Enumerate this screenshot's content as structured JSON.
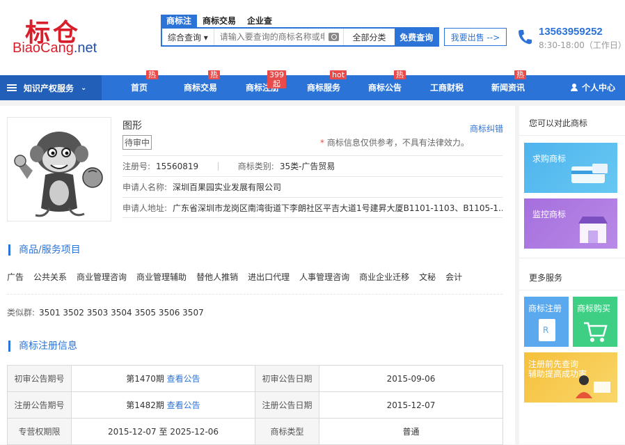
{
  "logo": {
    "cn": "标仓",
    "en_a": "BiaoCang",
    "en_b": ".net"
  },
  "search": {
    "tabs": [
      "商标注",
      "商标交易",
      "企业查"
    ],
    "select": "综合查询 ▾",
    "placeholder": "请输入要查询的商标名称或申",
    "category": "全部分类",
    "button": "免费查询"
  },
  "header": {
    "sell_button": "我要出售 -->",
    "phone": "13563959252",
    "hours": "8:30-18:00（工作日）"
  },
  "nav": {
    "category": "知识产权服务",
    "items": [
      {
        "label": "首页",
        "badge": "热"
      },
      {
        "label": "商标交易",
        "badge": "热"
      },
      {
        "label": "商标注册",
        "badge": "399起"
      },
      {
        "label": "商标服务",
        "badge": "hot"
      },
      {
        "label": "商标公告",
        "badge": "热"
      },
      {
        "label": "工商财税",
        "badge": ""
      },
      {
        "label": "新闻资讯",
        "badge": "热"
      }
    ],
    "user": "个人中心"
  },
  "trademark": {
    "name": "图形",
    "status": "待审中",
    "dispute": "商标纠错",
    "note_star": "*",
    "note": "商标信息仅供参考，不具有法律效力。",
    "reg_label": "注册号:",
    "reg_no": "15560819",
    "class_label": "商标类别:",
    "class": "35类-广告贸易",
    "applicant_label": "申请人名称:",
    "applicant": "深圳百果园实业发展有限公司",
    "address_label": "申请人地址:",
    "address": "广东省深圳市龙岗区南湾街道下李朗社区平吉大道1号建昇大厦B1101-1103、B1105-1..."
  },
  "goods": {
    "title": "商品/服务项目",
    "items": [
      "广告",
      "公共关系",
      "商业管理咨询",
      "商业管理辅助",
      "替他人推销",
      "进出口代理",
      "人事管理咨询",
      "商业企业迁移",
      "文秘",
      "会计"
    ],
    "similar_label": "类似群:",
    "similar": "3501 3502 3503 3504 3505 3506 3507"
  },
  "registration": {
    "title": "商标注册信息",
    "rows": [
      {
        "k1": "初审公告期号",
        "v1": "第1470期",
        "link1": "查看公告",
        "k2": "初审公告日期",
        "v2": "2015-09-06"
      },
      {
        "k1": "注册公告期号",
        "v1": "第1482期",
        "link1": "查看公告",
        "k2": "注册公告日期",
        "v2": "2015-12-07"
      },
      {
        "k1": "专营权期限",
        "v1": "2015-12-07 至 2025-12-06",
        "link1": "",
        "k2": "商标类型",
        "v2": "普通"
      }
    ]
  },
  "sidebar": {
    "title1": "您可以对此商标",
    "buy": "求购商标",
    "monitor": "监控商标",
    "title2": "更多服务",
    "register": "商标注册",
    "purchase": "商标购买",
    "consult_1": "注册前先查询",
    "consult_2": "辅助提高成功率"
  },
  "colors": {
    "primary": "#2b73d6",
    "brand_red": "#d81e2a",
    "badge_red": "#e94a4a"
  }
}
